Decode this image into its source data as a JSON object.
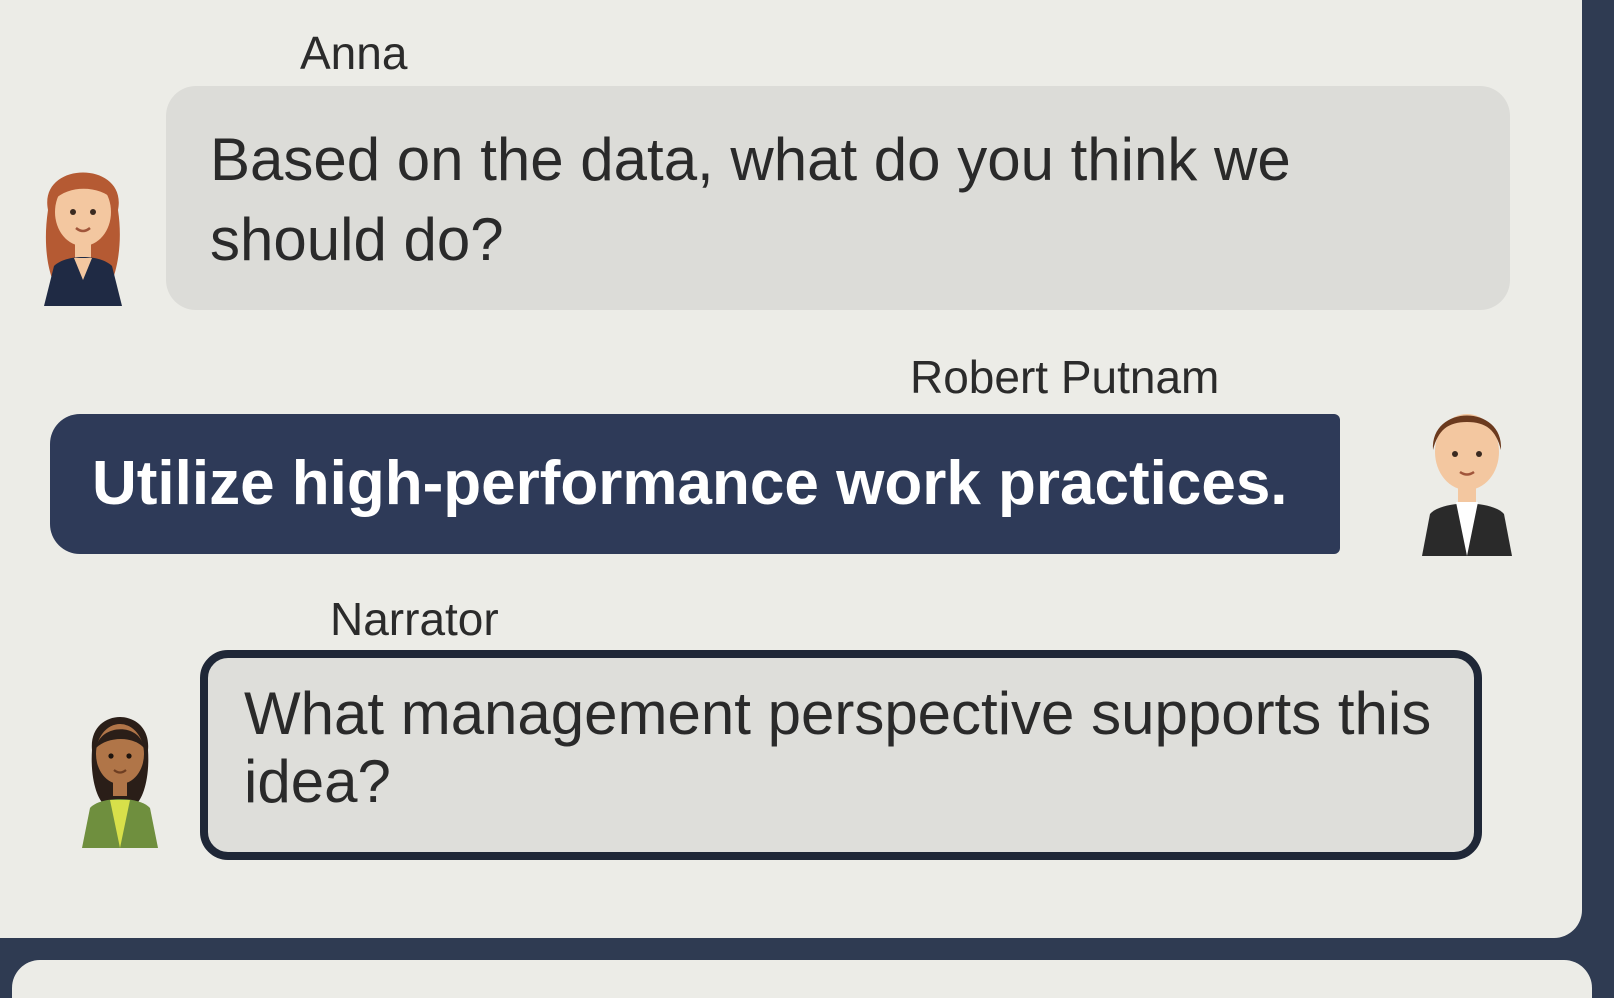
{
  "conversation": {
    "messages": [
      {
        "speaker": "Anna",
        "text": "Based on the data, what do you think we should do?"
      },
      {
        "speaker": "Robert Putnam",
        "text": "Utilize high-performance work practices."
      },
      {
        "speaker": "Narrator",
        "text": "What management perspective supports this idea?"
      }
    ]
  },
  "colors": {
    "panel": "#ecece7",
    "background": "#2f3b52",
    "anna_bubble": "#dcdcd8",
    "robert_bubble": "#2e3a58",
    "narrator_border": "#1f2737"
  },
  "icons": {
    "anna": "anna-avatar-icon",
    "robert": "robert-avatar-icon",
    "narrator": "narrator-avatar-icon"
  }
}
